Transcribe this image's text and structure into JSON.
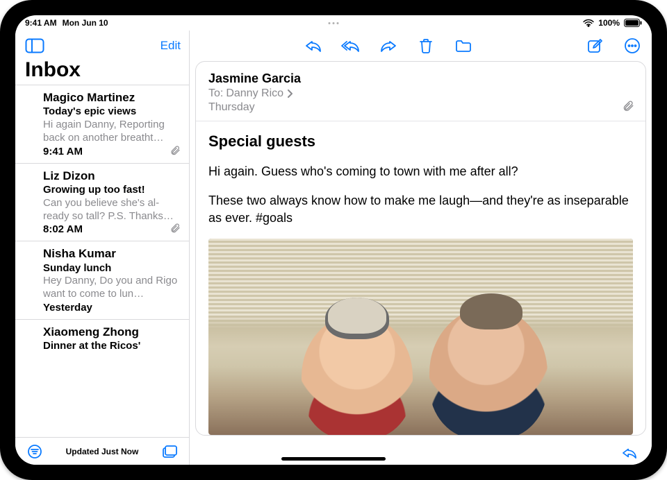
{
  "status": {
    "time": "9:41 AM",
    "date": "Mon Jun 10",
    "battery": "100%"
  },
  "sidebar": {
    "edit_label": "Edit",
    "title": "Inbox",
    "footer_status": "Updated Just Now",
    "items": [
      {
        "sender": "Magico Martinez",
        "subject": "Today's epic views",
        "preview": "Hi again Danny, Reporting back on another breatht…",
        "time": "9:41 AM",
        "has_attachment": true
      },
      {
        "sender": "Liz Dizon",
        "subject": "Growing up too fast!",
        "preview": "Can you believe she's al-ready so tall? P.S. Thanks…",
        "time": "8:02 AM",
        "has_attachment": true
      },
      {
        "sender": "Nisha Kumar",
        "subject": "Sunday lunch",
        "preview": "Hey Danny, Do you and Rigo want to come to lun…",
        "time": "Yesterday",
        "has_attachment": false
      },
      {
        "sender": "Xiaomeng Zhong",
        "subject": "Dinner at the Ricos'",
        "preview": "",
        "time": "",
        "has_attachment": false
      }
    ]
  },
  "mail": {
    "from": "Jasmine Garcia",
    "to_label": "To:",
    "to_name": "Danny Rico",
    "date": "Thursday",
    "has_attachment": true,
    "subject": "Special guests",
    "paragraphs": [
      "Hi again. Guess who's coming to town with me after all?",
      "These two always know how to make me laugh—and they're as inseparable as ever. #goals"
    ]
  },
  "icons": {
    "sidebar_toggle": "sidebar-toggle-icon",
    "reply": "reply-icon",
    "reply_all": "reply-all-icon",
    "forward": "forward-icon",
    "trash": "trash-icon",
    "move": "folder-icon",
    "compose": "compose-icon",
    "more": "more-icon",
    "filter": "filter-icon",
    "mailboxes": "mailboxes-icon",
    "attachment": "paperclip-icon",
    "chevron": "chevron-right-icon",
    "wifi": "wifi-icon",
    "battery": "battery-icon"
  },
  "colors": {
    "accent": "#0a7aff",
    "muted": "#8a8a8e"
  }
}
